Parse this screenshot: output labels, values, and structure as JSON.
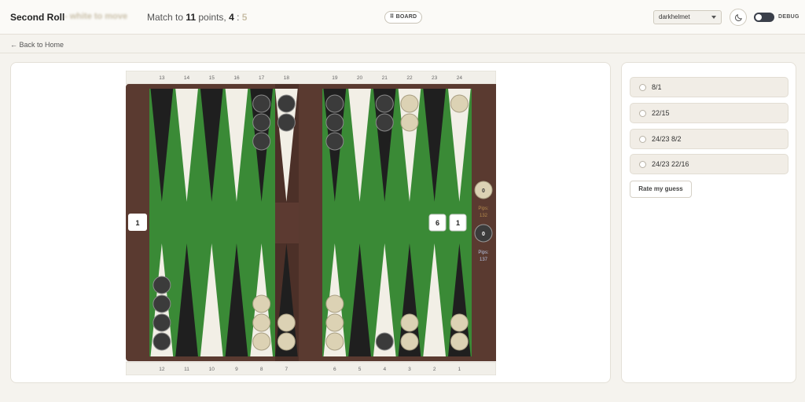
{
  "header": {
    "title": "Second Roll",
    "subtitle": "- white to move",
    "match_prefix": "Match to ",
    "match_points": "11",
    "match_suffix": " points, ",
    "score_1": "4",
    "score_sep": " : ",
    "score_2": "5",
    "board_button": "⠿ BOARD",
    "user": "darkhelmet",
    "debug_label": "DEBUG"
  },
  "nav": {
    "back": "← Back to Home"
  },
  "options": [
    "8/1",
    "22/15",
    "24/23 8/2",
    "24/23 22/16"
  ],
  "rate_button": "Rate my guess",
  "board": {
    "top_numbers": [
      "13",
      "14",
      "15",
      "16",
      "17",
      "18",
      "19",
      "20",
      "21",
      "22",
      "23",
      "24"
    ],
    "bottom_numbers": [
      "12",
      "11",
      "10",
      "9",
      "8",
      "7",
      "6",
      "5",
      "4",
      "3",
      "2",
      "1"
    ],
    "checkers": [
      {
        "point": 17,
        "color": "black",
        "count": 3
      },
      {
        "point": 18,
        "color": "black",
        "count": 2
      },
      {
        "point": 19,
        "color": "black",
        "count": 3
      },
      {
        "point": 21,
        "color": "black",
        "count": 2
      },
      {
        "point": 22,
        "color": "white",
        "count": 2
      },
      {
        "point": 24,
        "color": "white",
        "count": 1
      },
      {
        "point": 12,
        "color": "black",
        "count": 4
      },
      {
        "point": 8,
        "color": "white",
        "count": 3
      },
      {
        "point": 7,
        "color": "white",
        "count": 2
      },
      {
        "point": 6,
        "color": "white",
        "count": 3
      },
      {
        "point": 4,
        "color": "black",
        "count": 1
      },
      {
        "point": 3,
        "color": "white",
        "count": 2
      },
      {
        "point": 1,
        "color": "white",
        "count": 2
      }
    ],
    "cube": "1",
    "dice": [
      "6",
      "1"
    ],
    "white_off": "0",
    "white_pips_label": "Pips:",
    "white_pips": "132",
    "black_off": "0",
    "black_pips_label": "Pips:",
    "black_pips": "137",
    "colors": {
      "felt": "#3a8a36",
      "frame": "#5a3a30",
      "dark_point": "#1f1f1f",
      "light_point": "#f2efe6",
      "white_checker": "#dcd2b4",
      "black_checker": "#3b3b3b",
      "white_pips": "#b58a4c",
      "black_pips": "#b8c6e6"
    }
  }
}
